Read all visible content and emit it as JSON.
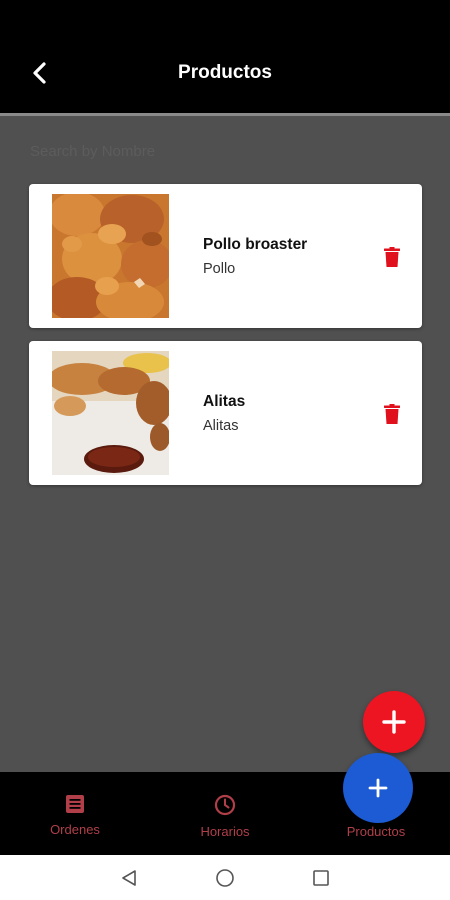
{
  "header": {
    "title": "Productos",
    "back_icon": "chevron-left-icon"
  },
  "search": {
    "placeholder": "Search by Nombre",
    "value": ""
  },
  "products": [
    {
      "name": "Pollo broaster",
      "category": "Pollo",
      "image": "fried-chicken",
      "delete_icon": "trash-icon"
    },
    {
      "name": "Alitas",
      "category": "Alitas",
      "image": "chicken-wings",
      "delete_icon": "trash-icon"
    }
  ],
  "fabs": [
    {
      "icon": "plus-icon",
      "color": "#ee1522"
    },
    {
      "icon": "plus-icon",
      "color": "#1c5bd4"
    }
  ],
  "bottom_nav": {
    "items": [
      {
        "label": "Ordenes",
        "icon": "list-icon"
      },
      {
        "label": "Horarios",
        "icon": "clock-icon"
      },
      {
        "label": "Productos",
        "icon": "cart-icon"
      }
    ]
  },
  "system_nav": {
    "buttons": [
      "back-triangle-icon",
      "home-circle-icon",
      "recents-square-icon"
    ]
  },
  "colors": {
    "accent_red": "#ee1522",
    "accent_blue": "#1c5bd4",
    "nav_label": "#b03f4a",
    "background": "#505050"
  }
}
